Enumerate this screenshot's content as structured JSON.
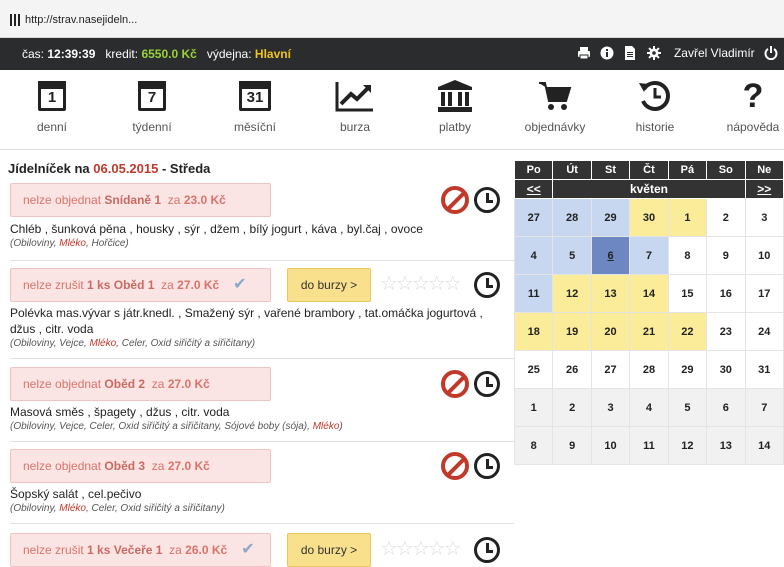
{
  "browser": {
    "url": "http://strav.nasejideln..."
  },
  "status": {
    "time_label": "čas:",
    "time": "12:39:39",
    "credit_label": "kredit:",
    "credit": "6550.0 Kč",
    "canteen_label": "výdejna:",
    "canteen": "Hlavní",
    "user": "Zavřel Vladimír"
  },
  "menu": {
    "items": [
      {
        "label": "denní",
        "num": "1"
      },
      {
        "label": "týdenní",
        "num": "7"
      },
      {
        "label": "měsíční",
        "num": "31"
      },
      {
        "label": "burza"
      },
      {
        "label": "platby"
      },
      {
        "label": "objednávky"
      },
      {
        "label": "historie"
      },
      {
        "label": "nápověda"
      }
    ]
  },
  "day": {
    "prefix": "Jídelníček na",
    "date": "06.05.2015",
    "weekday": "- Středa"
  },
  "meals": [
    {
      "status": "nelze objednat",
      "qty": "",
      "name": "Snídaně 1",
      "za": "za",
      "price": "23.0 Kč",
      "desc": "Chléb , šunková pěna , housky , sýr , džem , bílý jogurt , káva , byl.čaj , ovoce",
      "allergens": [
        "(Obiloviny, ",
        "Mléko",
        ", Hořčice)"
      ]
    },
    {
      "status": "nelze zrušit",
      "qty": "1 ks",
      "name": "Oběd 1",
      "za": "za",
      "price": "27.0 Kč",
      "burza": "do burzy >",
      "desc": "Polévka mas.vývar s játr.knedl. , Smažený sýr , vařené brambory , tat.omáčka jogurtová , džus , citr. voda",
      "allergens": [
        "(Obiloviny, Vejce, ",
        "Mléko",
        ", Celer, Oxid siřičitý a siřičitany)"
      ]
    },
    {
      "status": "nelze objednat",
      "qty": "",
      "name": "Oběd 2",
      "za": "za",
      "price": "27.0 Kč",
      "desc": "Masová směs , špagety , džus , citr. voda",
      "allergens": [
        "(Obiloviny, Vejce, Celer, Oxid siřičitý a siřičitany, Sójové boby (sója), ",
        "Mléko",
        ")"
      ]
    },
    {
      "status": "nelze objednat",
      "qty": "",
      "name": "Oběd 3",
      "za": "za",
      "price": "27.0 Kč",
      "desc": "Šopský salát , cel.pečivo",
      "allergens": [
        "(Obiloviny, ",
        "Mléko",
        ", Celer, Oxid siřičitý a siřičitany)"
      ]
    },
    {
      "status": "nelze zrušit",
      "qty": "1 ks",
      "name": "Večeře 1",
      "za": "za",
      "price": "26.0 Kč",
      "burza": "do burzy >"
    }
  ],
  "calendar": {
    "weekdays": [
      "Po",
      "Út",
      "St",
      "Čt",
      "Pá",
      "So",
      "Ne"
    ],
    "prev": "<<",
    "month": "květen",
    "next": ">>",
    "weeks": [
      [
        [
          "27",
          "gblue"
        ],
        [
          "28",
          "gblue"
        ],
        [
          "29",
          "gblue"
        ],
        [
          "30",
          "gyel"
        ],
        [
          "1",
          "yel"
        ],
        [
          "2",
          "wht"
        ],
        [
          "3",
          "wht"
        ]
      ],
      [
        [
          "4",
          "blue"
        ],
        [
          "5",
          "blue"
        ],
        [
          "6",
          "sel"
        ],
        [
          "7",
          "blue"
        ],
        [
          "8",
          "wht"
        ],
        [
          "9",
          "wht"
        ],
        [
          "10",
          "wht"
        ]
      ],
      [
        [
          "11",
          "blue"
        ],
        [
          "12",
          "yel"
        ],
        [
          "13",
          "yel"
        ],
        [
          "14",
          "yel"
        ],
        [
          "15",
          "wht"
        ],
        [
          "16",
          "wht"
        ],
        [
          "17",
          "wht"
        ]
      ],
      [
        [
          "18",
          "yel"
        ],
        [
          "19",
          "yel"
        ],
        [
          "20",
          "yel"
        ],
        [
          "21",
          "yel"
        ],
        [
          "22",
          "yel"
        ],
        [
          "23",
          "wht"
        ],
        [
          "24",
          "wht"
        ]
      ],
      [
        [
          "25",
          "wht"
        ],
        [
          "26",
          "wht"
        ],
        [
          "27",
          "wht"
        ],
        [
          "28",
          "wht"
        ],
        [
          "29",
          "wht"
        ],
        [
          "30",
          "wht"
        ],
        [
          "31",
          "wht"
        ]
      ],
      [
        [
          "1",
          "grey"
        ],
        [
          "2",
          "grey"
        ],
        [
          "3",
          "grey"
        ],
        [
          "4",
          "grey"
        ],
        [
          "5",
          "grey"
        ],
        [
          "6",
          "grey"
        ],
        [
          "7",
          "grey"
        ]
      ],
      [
        [
          "8",
          "grey"
        ],
        [
          "9",
          "grey"
        ],
        [
          "10",
          "grey"
        ],
        [
          "11",
          "grey"
        ],
        [
          "12",
          "grey"
        ],
        [
          "13",
          "grey"
        ],
        [
          "14",
          "grey"
        ]
      ]
    ]
  },
  "icons": {
    "print": "print-icon",
    "info": "info-icon",
    "doc": "document-icon",
    "settings": "gear-icon",
    "chart": "line-chart-icon",
    "bank": "bank-icon",
    "cart": "cart-icon",
    "history": "history-icon",
    "help": "question-icon"
  },
  "colors": {
    "dark_bar": "#2a2c2e",
    "credit": "#9ad23a",
    "canteen": "#f0c419",
    "date": "#c0392b",
    "order_box": "#fbe4e4",
    "burza": "#f8e08c",
    "selected_day": "#6d87c2"
  }
}
